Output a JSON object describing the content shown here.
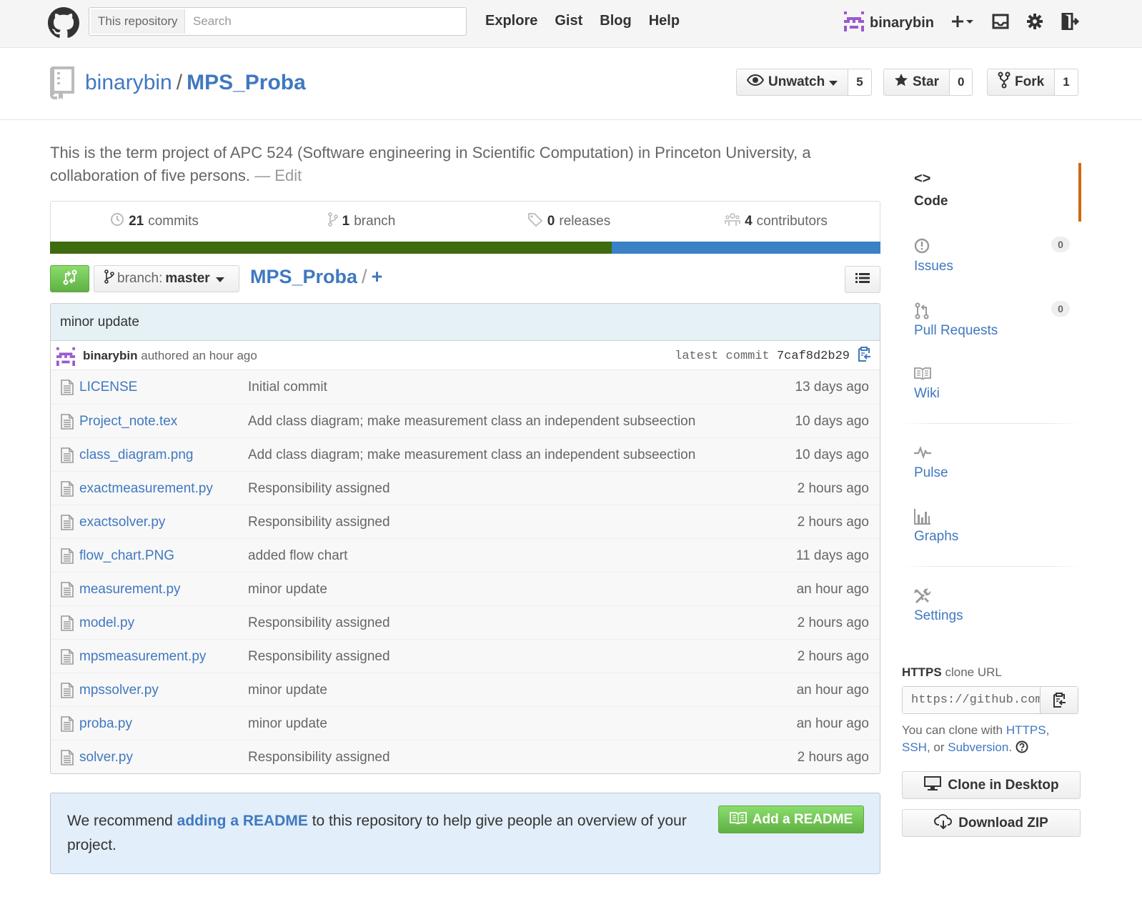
{
  "header": {
    "search_scope": "This repository",
    "search_placeholder": "Search",
    "nav": [
      "Explore",
      "Gist",
      "Blog",
      "Help"
    ],
    "username": "binarybin",
    "icons": [
      "github-logo-icon",
      "plus-icon",
      "inbox-icon",
      "gear-icon",
      "sign-out-icon"
    ]
  },
  "repo": {
    "owner": "binarybin",
    "separator": "/",
    "name": "MPS_Proba",
    "watch_label": "Unwatch",
    "watch_count": "5",
    "star_label": "Star",
    "star_count": "0",
    "fork_label": "Fork",
    "fork_count": "1",
    "description": "This is the term project of APC 524 (Software engineering in Scientific Computation) in Princeton University, a collaboration of five persons.",
    "edit_label": "— Edit"
  },
  "summary": {
    "commits_count": "21",
    "commits_label": "commits",
    "branch_count": "1",
    "branch_label": "branch",
    "releases_count": "0",
    "releases_label": "releases",
    "contributors_count": "4",
    "contributors_label": "contributors",
    "language_bar": [
      {
        "color": "#3f6b0f",
        "fraction": 0.676
      },
      {
        "color": "#3a81c5",
        "fraction": 0.324
      }
    ]
  },
  "file_nav": {
    "branch_prefix": "branch:",
    "branch_name": "master",
    "breadcrumb_repo": "MPS_Proba",
    "breadcrumb_sep": "/",
    "breadcrumb_add": "+"
  },
  "latest_commit": {
    "message": "minor update",
    "author": "binarybin",
    "authored_text": "authored an hour ago",
    "label": "latest commit",
    "sha": "7caf8d2b29"
  },
  "files": [
    {
      "name": "LICENSE",
      "message": "Initial commit",
      "age": "13 days ago"
    },
    {
      "name": "Project_note.tex",
      "message": "Add class diagram; make measurement class an independent subseection",
      "age": "10 days ago"
    },
    {
      "name": "class_diagram.png",
      "message": "Add class diagram; make measurement class an independent subseection",
      "age": "10 days ago"
    },
    {
      "name": "exactmeasurement.py",
      "message": "Responsibility assigned",
      "age": "2 hours ago"
    },
    {
      "name": "exactsolver.py",
      "message": "Responsibility assigned",
      "age": "2 hours ago"
    },
    {
      "name": "flow_chart.PNG",
      "message": "added flow chart",
      "age": "11 days ago"
    },
    {
      "name": "measurement.py",
      "message": "minor update",
      "age": "an hour ago"
    },
    {
      "name": "model.py",
      "message": "Responsibility assigned",
      "age": "2 hours ago"
    },
    {
      "name": "mpsmeasurement.py",
      "message": "Responsibility assigned",
      "age": "2 hours ago"
    },
    {
      "name": "mpssolver.py",
      "message": "minor update",
      "age": "an hour ago"
    },
    {
      "name": "proba.py",
      "message": "minor update",
      "age": "an hour ago"
    },
    {
      "name": "solver.py",
      "message": "Responsibility assigned",
      "age": "2 hours ago"
    }
  ],
  "readme": {
    "text_before": "We recommend ",
    "link": "adding a README",
    "text_after": " to this repository to help give people an overview of your project.",
    "button": "Add a README"
  },
  "sidebar": {
    "code": "Code",
    "issues": "Issues",
    "issues_count": "0",
    "pull_requests": "Pull Requests",
    "pull_requests_count": "0",
    "wiki": "Wiki",
    "pulse": "Pulse",
    "graphs": "Graphs",
    "settings": "Settings",
    "clone_proto": "HTTPS",
    "clone_label": "clone URL",
    "clone_url": "https://github.com/binarybin/MPS_Proba.git",
    "clone_help_prefix": "You can clone with ",
    "clone_help_https": "HTTPS",
    "clone_help_comma": ",",
    "clone_help_ssh": "SSH",
    "clone_help_or": ", or ",
    "clone_help_svn": "Subversion",
    "clone_help_end": ".",
    "clone_desktop": "Clone in Desktop",
    "download_zip": "Download ZIP"
  }
}
